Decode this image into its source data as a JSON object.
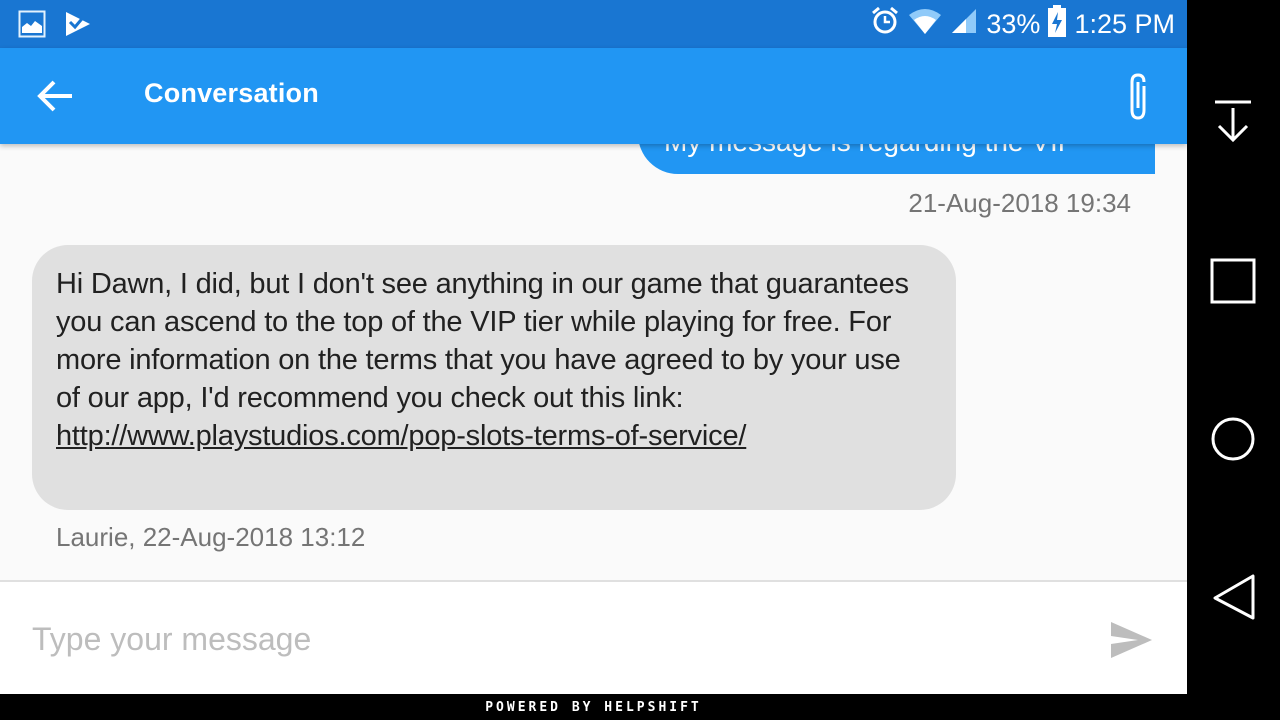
{
  "status_bar": {
    "left_icons": [
      "gallery-icon",
      "task-check-icon"
    ],
    "right_icons": [
      "alarm-icon",
      "wifi-icon",
      "signal-icon"
    ],
    "battery_percent": "33%",
    "battery_icon": "battery-charging-icon",
    "time": "1:25 PM"
  },
  "app_bar": {
    "back_icon": "arrow-back-icon",
    "title": "Conversation",
    "attach_icon": "paperclip-icon"
  },
  "messages": [
    {
      "direction": "outgoing",
      "text": "My message is regarding the VIP",
      "timestamp": "21-Aug-2018 19:34"
    },
    {
      "direction": "incoming",
      "text": "Hi Dawn, I did, but I don't see anything in our game that guarantees you can ascend to the top of the VIP tier while playing for free. For more information on the terms that you have agreed to by your use of our app, I'd recommend you check out this link: ",
      "link": "http://www.playstudios.com/pop-slots-terms-of-service/",
      "meta": "Laurie, 22-Aug-2018 13:12"
    }
  ],
  "input": {
    "placeholder": "Type your message",
    "value": "",
    "send_icon": "send-icon"
  },
  "footer": {
    "text": "POWERED BY HELPSHIFT"
  },
  "nav_bar": {
    "buttons": [
      {
        "name": "notification-pull-down-icon"
      },
      {
        "name": "recents-icon"
      },
      {
        "name": "home-icon"
      },
      {
        "name": "back-icon"
      }
    ]
  },
  "colors": {
    "status_bar": "#1976d2",
    "app_bar": "#2196f3",
    "outgoing_bubble": "#2196f3",
    "incoming_bubble": "#e0e0e0",
    "background": "#fafafa",
    "timestamp": "#757575",
    "placeholder": "#bdbdbd"
  }
}
